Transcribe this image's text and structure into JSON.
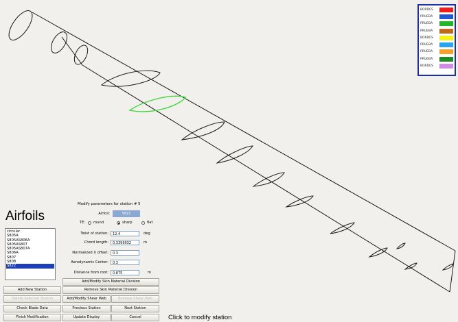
{
  "legend": {
    "items": [
      {
        "label": "BORDES",
        "color": "#ee1c1c"
      },
      {
        "label": "PRUEBA",
        "color": "#2457d6"
      },
      {
        "label": "PRUEBA",
        "color": "#20b82a"
      },
      {
        "label": "PRUEBA",
        "color": "#c06a1c"
      },
      {
        "label": "BORDES",
        "color": "#f5f21a"
      },
      {
        "label": "PRUEBA",
        "color": "#2aa4f0"
      },
      {
        "label": "PRUEBA",
        "color": "#f4a02a"
      },
      {
        "label": "PRUEBA",
        "color": "#1e8c26"
      },
      {
        "label": "BORDES",
        "color": "#cf8ce6"
      }
    ]
  },
  "airfoils": {
    "title": "Airfoils",
    "items": [
      "circular",
      "S805A",
      "S805AS806A",
      "S805AS807",
      "S805AS807A",
      "S806A",
      "S807",
      "S808",
      "S822"
    ],
    "selected_index": 8
  },
  "station_form": {
    "title": "Modify parameters for station # 5",
    "airfoil_label": "Airfoil:",
    "airfoil_value": "S822",
    "te_label": "TE:",
    "te_options": [
      "round",
      "sharp",
      "flat"
    ],
    "te_selected": "sharp",
    "twist_label": "Twist of station:",
    "twist_value": "12.4",
    "twist_unit": "deg",
    "chord_label": "Chord length:",
    "chord_value": "0.3399932",
    "chord_unit": "m",
    "xoffset_label": "Normalized X offset:",
    "xoffset_value": "0.3",
    "aero_label": "Aerodynamic Center:",
    "aero_value": "0.3",
    "distance_label": "Distance from root:",
    "distance_value": "0.875",
    "distance_unit": "m"
  },
  "buttons": {
    "add_new_station": "Add New Station",
    "delete_selected_station": "Delete Selected Station",
    "check_blade_data": "Check Blade Data",
    "finish_modification": "Finish Modification",
    "add_modify_skin": "Add/Modify Skin Material Division",
    "remove_skin": "Remove Skin Material Division",
    "add_modify_shear_web": "Add/Modify Shear Web",
    "remove_shear_web": "Remove Shear Web",
    "previous_station": "Previous Station",
    "next_station": "Next Station",
    "update_display": "Update Display",
    "cancel": "Cancel"
  },
  "status": {
    "message": "Click to modify station"
  },
  "colors": {
    "highlight_station": "#3ed63a",
    "outline": "#1a1a1a"
  }
}
